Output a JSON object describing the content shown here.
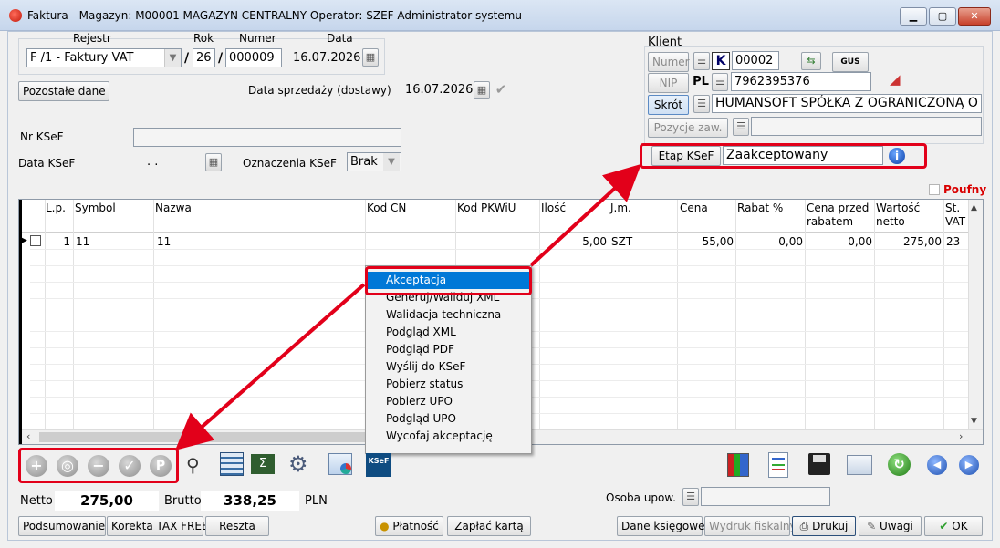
{
  "window": {
    "title": "Faktura - Magazyn: M00001 MAGAZYN CENTRALNY  Operator: SZEF Administrator systemu",
    "min": "▁",
    "max": "▢",
    "close": "✕"
  },
  "header": {
    "rejestr_label": "Rejestr",
    "rok_label": "Rok",
    "numer_label": "Numer",
    "data_label": "Data",
    "rejestr_value": "F /1  - Faktury VAT",
    "slash": "/",
    "rok_value": "26",
    "numer_value": "000009",
    "data_value": "16.07.2026",
    "pozostale_dane": "Pozostałe dane",
    "data_sprzedazy_label": "Data sprzedaży (dostawy)",
    "data_sprzedazy_value": "16.07.2026",
    "nr_ksef_label": "Nr KSeF",
    "nr_ksef_value": "",
    "data_ksef_label": "Data KSeF",
    "data_ksef_value": ".  .",
    "oznaczenia_label": "Oznaczenia KSeF",
    "oznaczenia_value": "Brak"
  },
  "client": {
    "label": "Klient",
    "numer_btn": "Numer",
    "k_badge": "K",
    "numer_value": "00002",
    "gus": "GUS",
    "nip_btn": "NIP",
    "pl_badge": "PL",
    "nip_value": "7962395376",
    "skrot_btn": "Skrót",
    "skrot_value": "HUMANSOFT SPÓŁKA Z OGRANICZONĄ O",
    "pozycje_btn": "Pozycje zaw.",
    "etap_label": "Etap KSeF",
    "etap_value": "Zaakceptowany",
    "poufny": "Poufny"
  },
  "grid": {
    "columns": [
      "L.p.",
      "Symbol",
      "Nazwa",
      "Kod CN",
      "Kod PKWiU",
      "Ilość",
      "J.m.",
      "Cena",
      "Rabat %",
      "Cena przed rabatem",
      "Wartość netto",
      "St. VAT"
    ],
    "col_cena_przed_1": "Cena przed",
    "col_cena_przed_2": "rabatem",
    "col_wartosc_1": "Wartość",
    "col_wartosc_2": "netto",
    "col_st_1": "St.",
    "col_st_2": "VAT",
    "rows": [
      {
        "lp": "1",
        "symbol": "11",
        "nazwa": "11",
        "kod_cn": "",
        "kod_pkwiu": "",
        "ilosc": "5,00",
        "jm": "SZT",
        "cena": "55,00",
        "rabat": "0,00",
        "cena_przed": "0,00",
        "wartosc": "275,00",
        "vat": "23"
      }
    ]
  },
  "context_menu": {
    "items": [
      "Akceptacja",
      "Generuj/Waliduj XML",
      "Walidacja techniczna",
      "Podgląd XML",
      "Podgląd PDF",
      "Wyślij do KSeF",
      "Pobierz status",
      "Pobierz UPO",
      "Podgląd UPO",
      "Wycofaj akceptację"
    ],
    "selected_index": 0
  },
  "toolbar": {
    "add": "+",
    "zoom": "◎",
    "remove": "−",
    "edit": "✓",
    "p": "P",
    "ksef_icon_label": "KSeF"
  },
  "totals": {
    "netto_label": "Netto",
    "netto_value": "275,00",
    "brutto_label": "Brutto",
    "brutto_value": "338,25",
    "currency": "PLN",
    "osoba_label": "Osoba upow."
  },
  "bottom_buttons": {
    "podsumowanie": "Podsumowanie",
    "korekta": "Korekta TAX FREE",
    "reszta": "Reszta",
    "platnosc": "Płatność",
    "zaplac_karta": "Zapłać kartą",
    "dane_ksiegowe": "Dane księgowe",
    "wydruk_fiskalny": "Wydruk fiskalny",
    "drukuj": "Drukuj",
    "uwagi": "Uwagi",
    "ok": "OK"
  },
  "colors": {
    "highlight_red": "#e2001a",
    "menu_selected": "#0078d7"
  }
}
